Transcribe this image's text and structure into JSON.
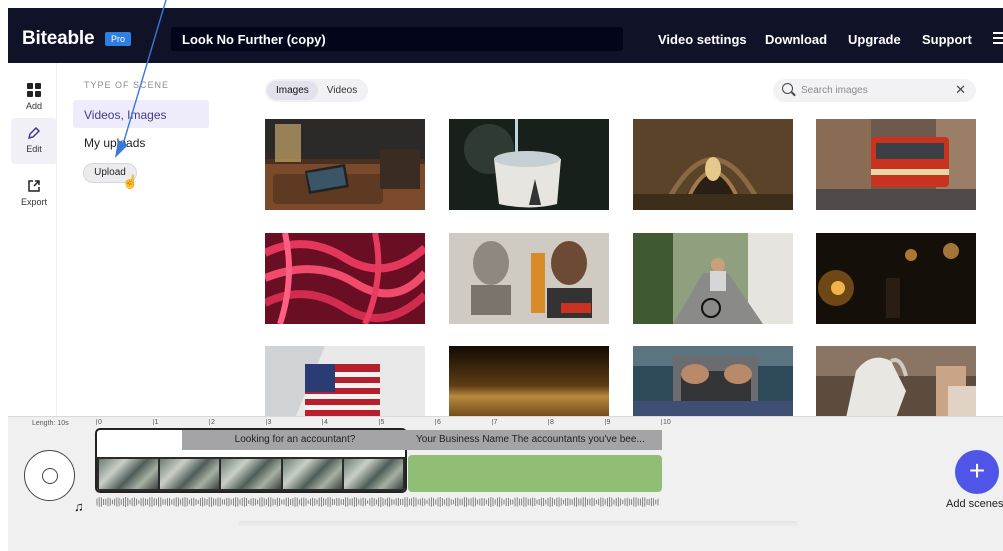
{
  "header": {
    "logo": "Biteable",
    "badge": "Pro",
    "project_title": "Look No Further (copy)",
    "nav": [
      "Video settings",
      "Download",
      "Upgrade",
      "Support"
    ],
    "menu_icon": "hamburger-icon"
  },
  "rail": {
    "items": [
      {
        "label": "Add",
        "icon": "grid-icon"
      },
      {
        "label": "Edit",
        "icon": "pencil-icon"
      },
      {
        "label": "Export",
        "icon": "export-icon"
      }
    ]
  },
  "panel": {
    "heading": "TYPE OF SCENE",
    "items": [
      "Videos, Images",
      "My uploads"
    ],
    "upload_label": "Upload"
  },
  "content": {
    "tabs": [
      "Images",
      "Videos"
    ],
    "search_placeholder": "Search images",
    "clear_icon": "close-icon",
    "images": [
      "living-room-laptop",
      "pouring-mug",
      "stone-arcade",
      "red-tram",
      "pink-rope",
      "mural-wall",
      "cyclist-street",
      "dark-lamp-room",
      "american-flag",
      "wood-surface",
      "laptop-hands",
      "white-horse"
    ]
  },
  "timeline": {
    "length_label": "Length: 10s",
    "ruler": [
      "0",
      "1",
      "2",
      "3",
      "4",
      "5",
      "6",
      "7",
      "8",
      "9",
      "10"
    ],
    "scene1_label": "Looking for an accountant?",
    "scene2_label": "Your Business Name The accountants you've bee...",
    "add_scene_label": "Add scenes",
    "add_icon": "plus-icon",
    "music_icon": "music-note-icon"
  },
  "colors": {
    "header_bg": "#101227",
    "accent": "#4f55e6",
    "pro_badge": "#2f7fe0",
    "active_item_bg": "#eeecfa",
    "scene_green": "#8fbe74"
  }
}
